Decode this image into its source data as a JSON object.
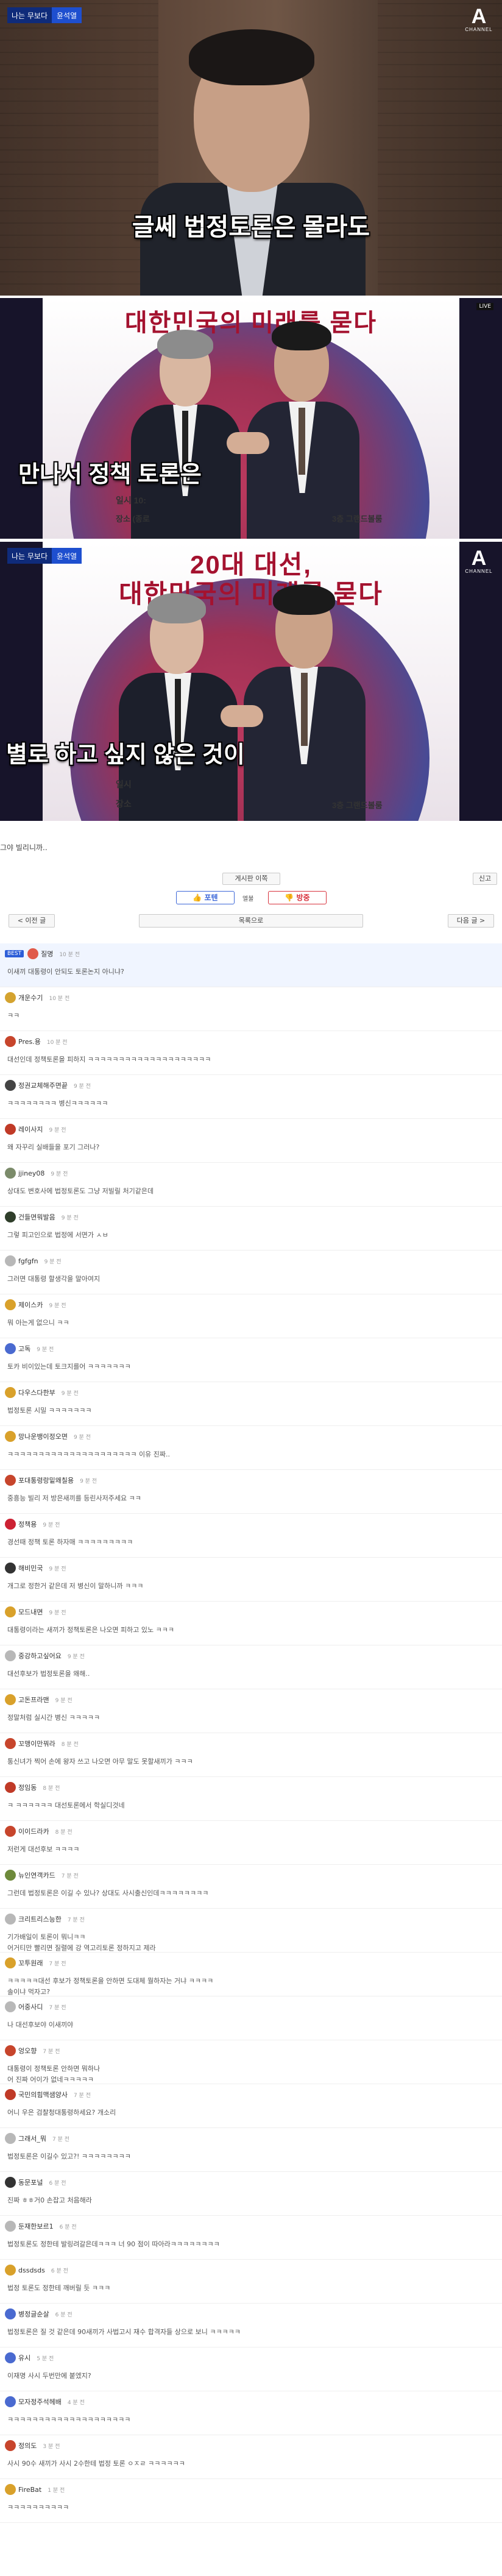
{
  "frame1": {
    "tag_left": "나는 무보다",
    "tag_right": "윤석열",
    "subtitle": "글쎄 법정토론은 몰라도",
    "logo_big": "A",
    "logo_small": "CHANNEL"
  },
  "frame2": {
    "poster_title": "대한민국의 미래를 묻다",
    "subtitle": "만나서 정책 토론은",
    "bottom_left": "일시   10:",
    "bottom_left2": "장소   (종로",
    "bottom_right": "3층 그랜드볼룸",
    "live": "LIVE"
  },
  "frame3": {
    "tag_left": "나는 무보다",
    "tag_right": "윤석열",
    "poster_title_line1": "20대 대선,",
    "poster_title_line2": "대한민국의 미래를 묻다",
    "subtitle": "별로 하고 싶지 않은 것이",
    "bottom_left": "일시",
    "bottom_left2": "장소",
    "bottom_right": "3층 그랜드볼룸",
    "logo_big": "A",
    "logo_small": "CHANNEL"
  },
  "post": {
    "caption": "그야 빌리니까..",
    "report_label": "신고",
    "bookmark_label": "게시판 이쪽",
    "up_label": "포텐",
    "up_count": "엘불",
    "down_label": "방중",
    "prev_label": "< 이전 글",
    "list_label": "목록으로",
    "next_label": "다음 글 >"
  },
  "comments": [
    {
      "name": "질명",
      "time": "10 분 전",
      "body": "이새끼 대통령이 안되도 토론논지 아니냐?",
      "best": true,
      "best_label": "BEST",
      "avatar_color": "#e05a4a"
    },
    {
      "name": "개운수기",
      "time": "10 분 전",
      "body": "ㅋㅋ",
      "avatar_color": "#d4a32f"
    },
    {
      "name": "Pres.용",
      "time": "10 분 전",
      "body": "대선인데 정책토론을 피하지 ㅋㅋㅋㅋㅋㅋㅋㅋㅋㅋㅋㅋㅋㅋㅋㅋㅋㅋㅋㅋ",
      "avatar_color": "#c7452c"
    },
    {
      "name": "정권교체해주면끝",
      "time": "9 분 전",
      "body": "ㅋㅋㅋㅋㅋㅋㅋㅋ 병신ㅋㅋㅋㅋㅋㅋ",
      "avatar_color": "#444444"
    },
    {
      "name": "레이사지",
      "time": "9 분 전",
      "body": "왜 자꾸리 실배들을 포기 그러나?",
      "avatar_color": "#c03a27"
    },
    {
      "name": "jjiney08",
      "time": "9 분 전",
      "body": "상대도 변호사에 법정토론도 그냥 저빌릴 처기같은데",
      "avatar_color": "#7b8b6a"
    },
    {
      "name": "건들면뭐발음",
      "time": "9 분 전",
      "body": "그렇 피고인으로 법정에 서면가 ㅅㅂ",
      "avatar_color": "#2f3e2a"
    },
    {
      "name": "fgfgfn",
      "time": "9 분 전",
      "body": "그러면 대통령 할생각을 말아여지",
      "avatar_color": "#b8b8b8"
    },
    {
      "name": "제이스카",
      "time": "9 분 전",
      "body": "뭐 아는게 없으니 ㅋㅋ",
      "avatar_color": "#d9a12b"
    },
    {
      "name": "고독",
      "time": "9 분 전",
      "body": "토카 비이있는데 토크지를어 ㅋㅋㅋㅋㅋㅋㅋ",
      "avatar_color": "#4a6ad0"
    },
    {
      "name": "다우스다한부",
      "time": "9 분 전",
      "body": "법정토론 시밀 ㅋㅋㅋㅋㅋㅋㅋ",
      "avatar_color": "#d9a12b"
    },
    {
      "name": "망나운뱅이정오면",
      "time": "9 분 전",
      "body": "ㅋㅋㅋㅋㅋㅋㅋㅋㅋㅋㅋㅋㅋㅋㅋㅋㅋㅋㅋㅋㅋ 이유 진짜..",
      "avatar_color": "#d9a12b"
    },
    {
      "name": "포대통령랑밑왜칠용",
      "time": "9 분 전",
      "body": "중흥능 빌리 저 방은새끼를 등린사저주세요 ㅋㅋ",
      "avatar_color": "#c7452c"
    },
    {
      "name": "정책용",
      "time": "9 분 전",
      "body": "경선때 정책 토론 하자매 ㅋㅋㅋㅋㅋㅋㅋㅋㅋ",
      "avatar_color": "#cc2233"
    },
    {
      "name": "해비민국",
      "time": "9 분 전",
      "body": "개그로 정한거 같은데 저 병신이 말하니까 ㅋㅋㅋ",
      "avatar_color": "#333333"
    },
    {
      "name": "모드내면",
      "time": "9 분 전",
      "body": "대통령이라는 새끼가 정책토론은 나오면 피하고 있노 ㅋㅋㅋ",
      "avatar_color": "#d9a12b"
    },
    {
      "name": "중강하고싶어요",
      "time": "9 분 전",
      "body": "대선후보가 법정토론을 왜해..",
      "avatar_color": "#b8b8b8"
    },
    {
      "name": "고돈프라맨",
      "time": "9 분 전",
      "body": "정말처럼 실시간 병신 ㅋㅋㅋㅋㅋ",
      "avatar_color": "#d9a12b"
    },
    {
      "name": "꼬맹이만꿔라",
      "time": "8 분 전",
      "body": "통신녀가 찍어 손에 왕자 쓰고 나오면 아무 말도 못할새끼가 ㅋㅋㅋ",
      "avatar_color": "#c7452c"
    },
    {
      "name": "정임동",
      "time": "8 분 전",
      "body": "ㅋ ㅋㅋㅋㅋㅋㅋ 대선토론에서 학실디것네",
      "avatar_color": "#c03a27"
    },
    {
      "name": "이이드라카",
      "time": "8 분 전",
      "body": "저런게 대선후보 ㅋㅋㅋㅋ",
      "avatar_color": "#c7452c"
    },
    {
      "name": "뉴인연객카드",
      "time": "7 분 전",
      "body": "그런데 법정토론은 이길 수 있나? 상대도 사시출신인데ㅋㅋㅋㅋㅋㅋㅋㅋ",
      "avatar_color": "#6e8a3b"
    },
    {
      "name": "크리트리스능한",
      "time": "7 분 전",
      "body": "기가배일이 토론이 뭐니ㅋㅋ\n어거티만 빨리면 질렬에 강 역고리토론 정하지고 제라",
      "avatar_color": "#b8b8b8"
    },
    {
      "name": "꼬투원래",
      "time": "7 분 전",
      "body": "ㅋㅋㅋㅋㅋ대선 후보가 정책토론을 안하면 도대체 뭘하자는 거냐 ㅋㅋㅋㅋ\n솔이냐 먹자고?",
      "avatar_color": "#d9a12b"
    },
    {
      "name": "어중사디",
      "time": "7 분 전",
      "body": "나 대선후보야 이새끼야",
      "avatar_color": "#b8b8b8"
    },
    {
      "name": "엉오향",
      "time": "7 분 전",
      "body": "대통령이 정책토론 안하면 뭐하나\n어 진짜 어이가 없네ㅋㅋㅋㅋㅋ",
      "avatar_color": "#c7452c"
    },
    {
      "name": "국민의힘맥샘양사",
      "time": "7 분 전",
      "body": "어니 우은 검찰청대통령하세요? 개소리",
      "avatar_color": "#c03a27"
    },
    {
      "name": "그래서_뭐",
      "time": "7 분 전",
      "body": "법정토론은 이길수 있고?! ㅋㅋㅋㅋㅋㅋㅋㅋ",
      "avatar_color": "#b8b8b8"
    },
    {
      "name": "동문포널",
      "time": "6 분 전",
      "body": "진짜 ㅎㅎ거0 손잡고 처음해라",
      "avatar_color": "#333333"
    },
    {
      "name": "둔재한보르1",
      "time": "6 분 전",
      "body": "법정토론도 정한테 발링려갈은데ㅋㅋㅋ 너 90 점이 따아라ㅋㅋㅋㅋㅋㅋㅋㅋ",
      "avatar_color": "#b8b8b8"
    },
    {
      "name": "dssdsds",
      "time": "6 분 전",
      "body": "법정 토론도 정한테 깨버릴 듯 ㅋㅋㅋ",
      "avatar_color": "#d9a12b"
    },
    {
      "name": "병정글순살",
      "time": "6 분 전",
      "body": "법정토론은 질 것 같은데 90새끼가 사법고시 재수 합격자들 상으로 보니 ㅋㅋㅋㅋㅋ",
      "avatar_color": "#4a6ad0"
    },
    {
      "name": "유시",
      "time": "5 분 전",
      "body": "이재명 사시 두번만에 붙엤지?",
      "avatar_color": "#4a6ad0"
    },
    {
      "name": "모자정주석헤배",
      "time": "4 분 전",
      "body": "ㅋㅋㅋㅋㅋㅋㅋㅋㅋㅋㅋㅋㅋㅋㅋㅋㅋㅋㅋㅋ",
      "avatar_color": "#4a6ad0"
    },
    {
      "name": "정의도",
      "time": "3 분 전",
      "body": "사시 90수 새끼가 사시 2수한테 법정 토론 ㅇㅈㄹ ㅋㅋㅋㅋㅋㅋ",
      "avatar_color": "#c7452c"
    },
    {
      "name": "FireBat",
      "time": "1 분 전",
      "body": "ㅋㅋㅋㅋㅋㅋㅋㅋㅋㅋ",
      "avatar_color": "#d9a12b"
    }
  ]
}
